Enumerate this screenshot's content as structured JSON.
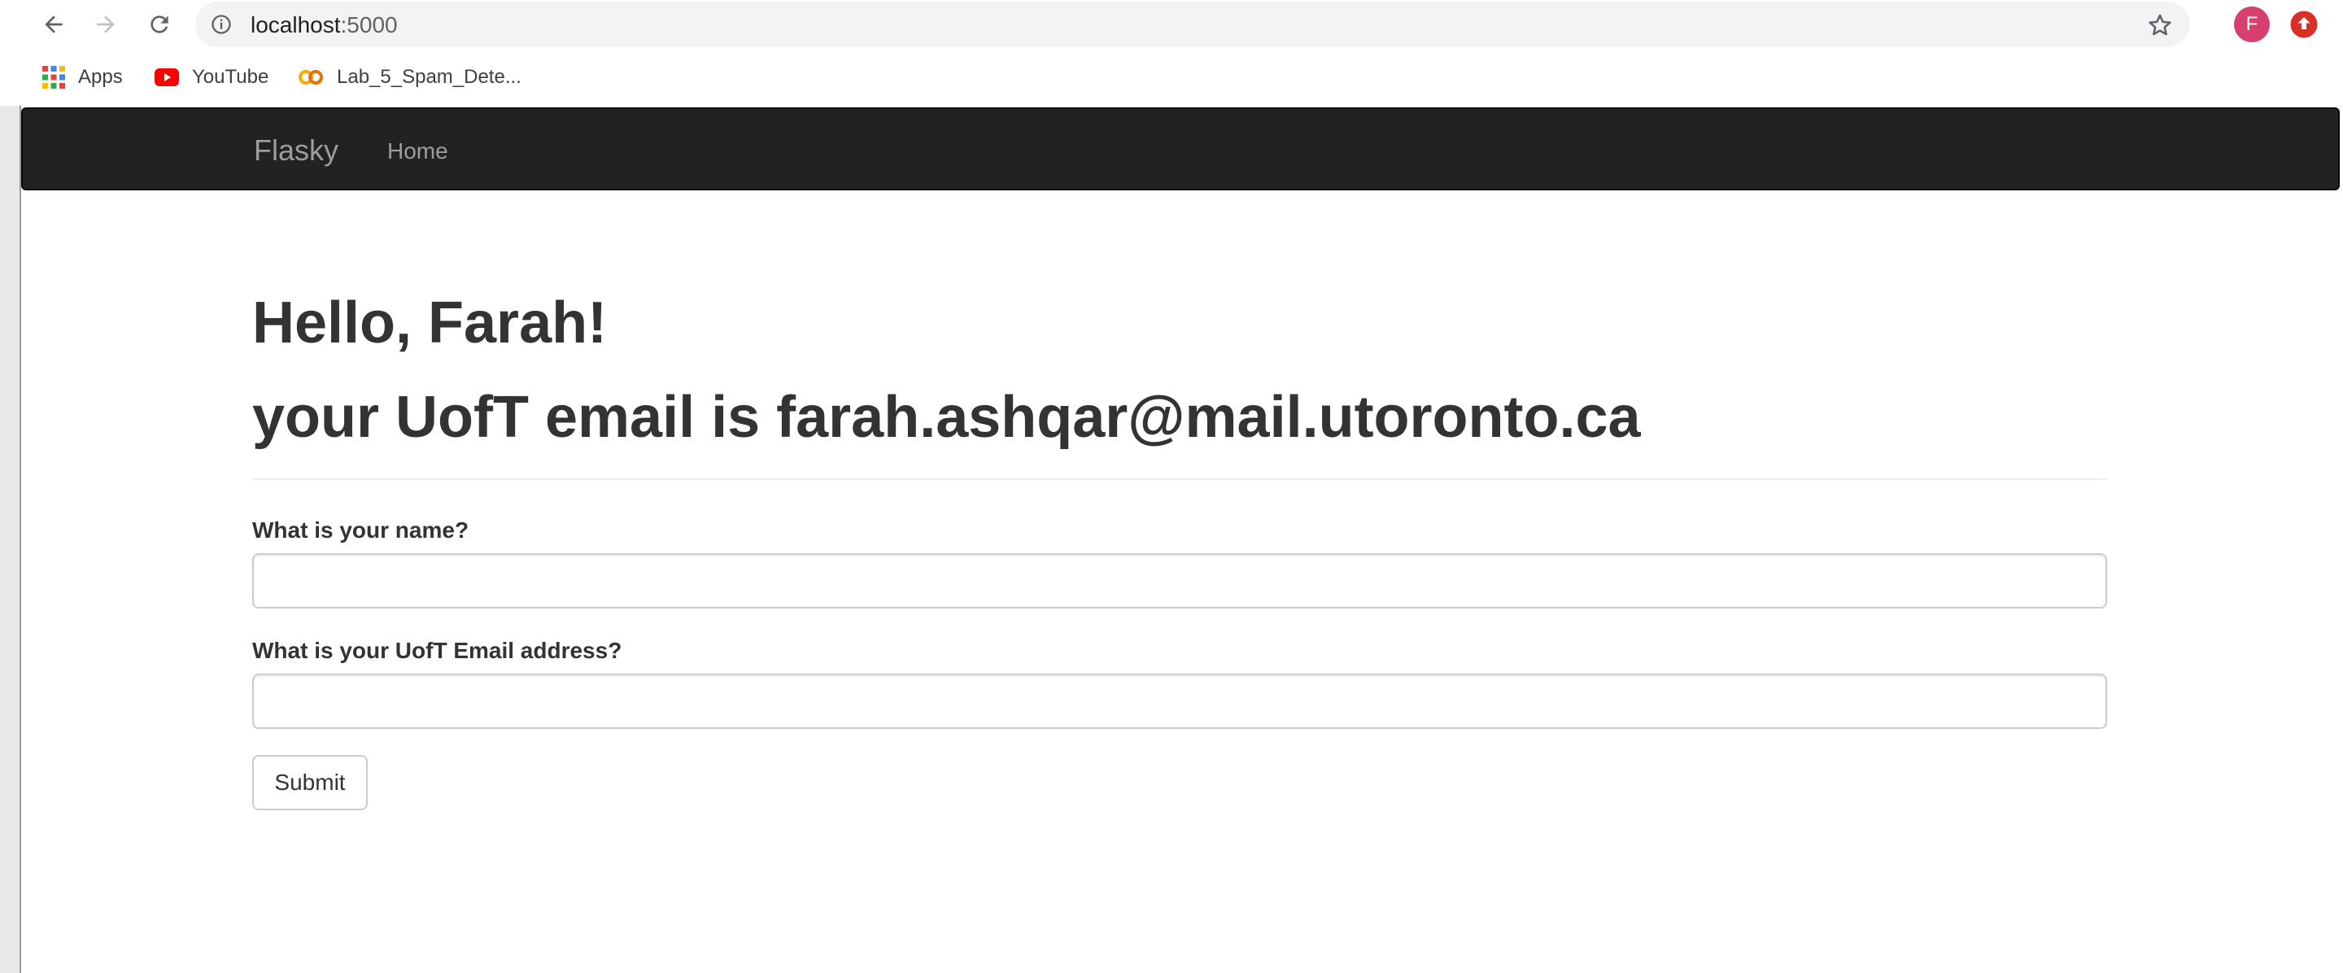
{
  "browser": {
    "url_host": "localhost",
    "url_port": ":5000",
    "profile_initial": "F",
    "bookmarks": [
      {
        "label": "Apps",
        "icon": "apps-grid-icon"
      },
      {
        "label": "YouTube",
        "icon": "youtube-icon"
      },
      {
        "label": "Lab_5_Spam_Dete...",
        "icon": "colab-icon"
      }
    ]
  },
  "navbar": {
    "brand": "Flasky",
    "links": [
      "Home"
    ]
  },
  "main": {
    "greeting": "Hello, Farah!",
    "email_line": "your UofT email is farah.ashqar@mail.utoronto.ca"
  },
  "form": {
    "name_label": "What is your name?",
    "name_value": "",
    "email_label": "What is your UofT Email address?",
    "email_value": "",
    "submit_label": "Submit"
  },
  "colors": {
    "navbar_bg": "#222222",
    "nav_text": "#9d9d9d",
    "heading_text": "#333333",
    "profile_bg": "#d5406f"
  }
}
